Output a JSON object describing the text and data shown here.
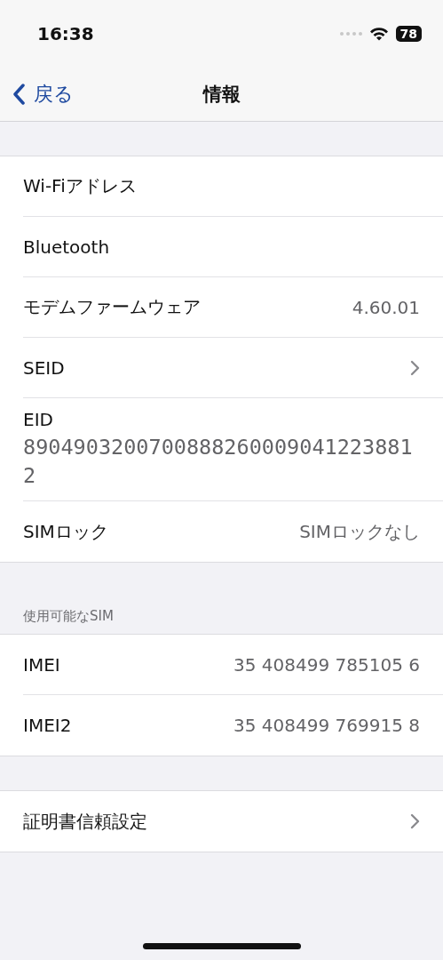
{
  "status_bar": {
    "time": "16:38",
    "battery": "78"
  },
  "nav": {
    "back": "戻る",
    "title": "情報"
  },
  "groups": [
    {
      "rows": [
        {
          "kind": "value",
          "label": "Wi-Fiアドレス"
        },
        {
          "kind": "value",
          "label": "Bluetooth"
        },
        {
          "kind": "value",
          "label": "モデムファームウェア",
          "value": "4.60.01"
        },
        {
          "kind": "chevron",
          "label": "SEID"
        },
        {
          "kind": "stacked",
          "label": "EID",
          "value": "89049032007008882600090412238812"
        },
        {
          "kind": "value",
          "label": "SIMロック",
          "value": "SIMロックなし"
        }
      ]
    },
    {
      "header": "使用可能なSIM",
      "rows": [
        {
          "kind": "value",
          "label": "IMEI",
          "value": "35 408499 785105 6"
        },
        {
          "kind": "value",
          "label": "IMEI2",
          "value": "35 408499 769915 8"
        }
      ]
    },
    {
      "rows": [
        {
          "kind": "chevron",
          "label": "証明書信頼設定"
        }
      ]
    }
  ]
}
